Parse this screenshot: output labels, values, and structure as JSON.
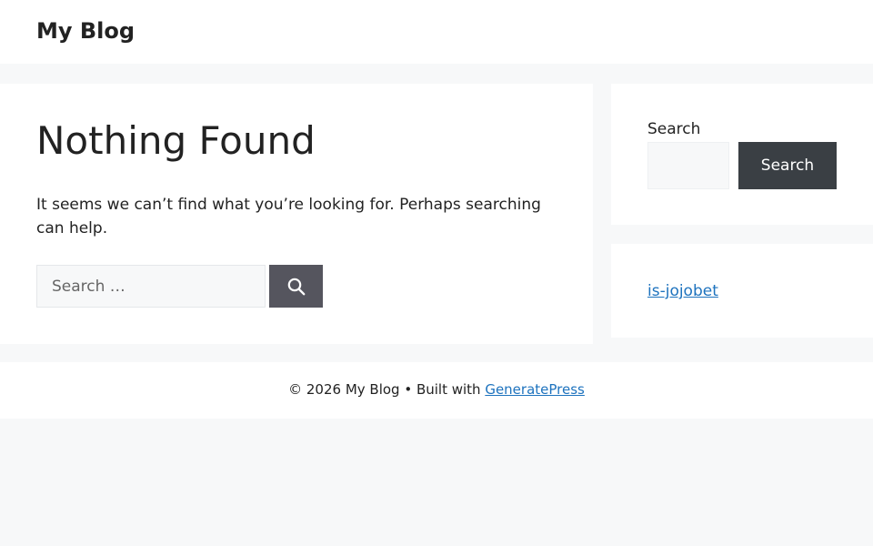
{
  "header": {
    "site_title": "My Blog"
  },
  "main": {
    "title": "Nothing Found",
    "message": "It seems we can’t find what you’re looking for. Perhaps searching can help.",
    "search": {
      "placeholder": "Search …",
      "value": "",
      "button_icon": "search-icon"
    }
  },
  "sidebar": {
    "search_widget": {
      "label": "Search",
      "value": "",
      "button_label": "Search"
    },
    "links": [
      {
        "label": "is-jojobet"
      }
    ]
  },
  "footer": {
    "prefix": "© 2026 My Blog • Built with ",
    "link_label": "GeneratePress"
  },
  "colors": {
    "page_background": "#f7f8f9",
    "card_background": "#ffffff",
    "text": "#222222",
    "link": "#1e73be",
    "main_search_button": "#55555e",
    "widget_search_button": "#3a3f44"
  }
}
